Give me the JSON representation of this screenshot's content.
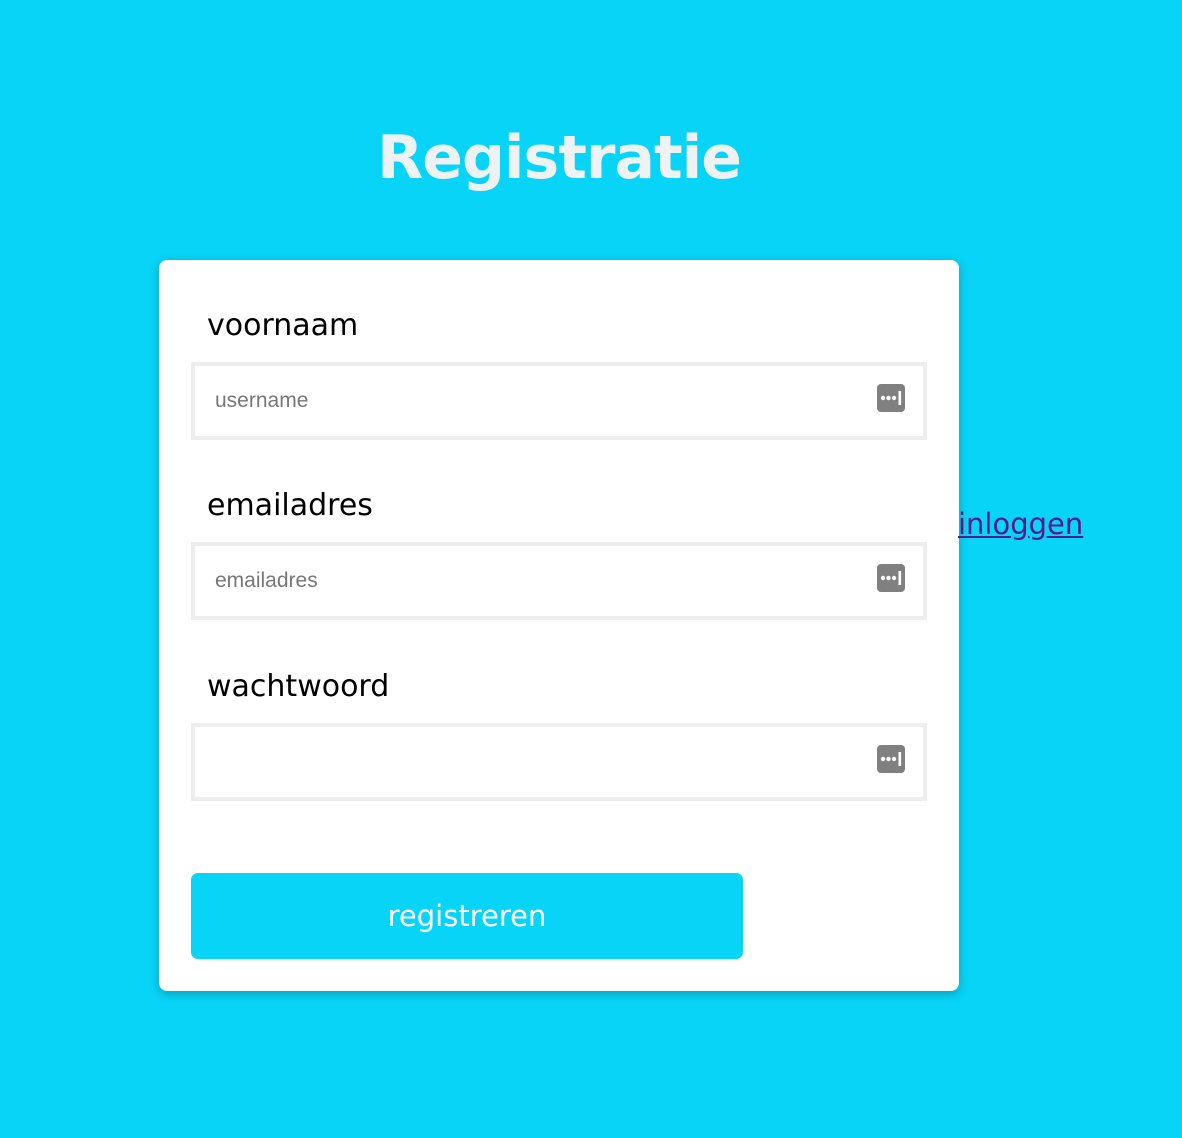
{
  "page": {
    "title": "Registratie",
    "background_color": "#08d4f7"
  },
  "form": {
    "fields": [
      {
        "label": "voornaam",
        "placeholder": "username",
        "value": "",
        "type": "text",
        "icon": "password-manager-icon"
      },
      {
        "label": "emailadres",
        "placeholder": "emailadres",
        "value": "",
        "type": "email",
        "icon": "password-manager-icon"
      },
      {
        "label": "wachtwoord",
        "placeholder": "",
        "value": "",
        "type": "password",
        "icon": "password-manager-icon"
      }
    ],
    "submit_label": "registreren",
    "submit_color": "#08d4f7"
  },
  "nav": {
    "login_link": "inloggen",
    "link_color": "#551a8b"
  }
}
